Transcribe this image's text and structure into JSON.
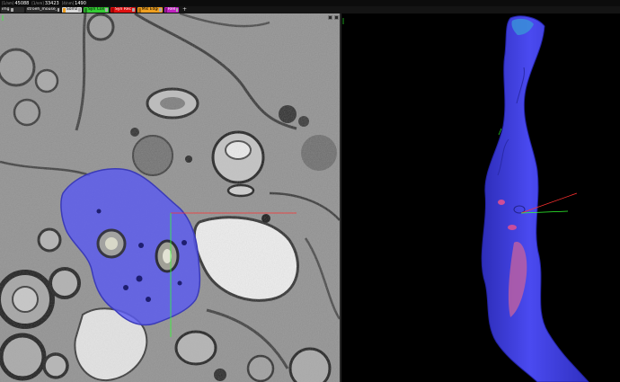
{
  "coordinates": [
    {
      "axis": "x",
      "label": "[1/nm]",
      "value": "45088"
    },
    {
      "axis": "y",
      "label": "[1/nm]",
      "value": "33423"
    },
    {
      "axis": "z",
      "label": "[4/nm]",
      "value": "1490"
    }
  ],
  "layers": [
    {
      "name": "img",
      "text_color": "#ffffff",
      "bg": "#2b2b2b",
      "swatch": ""
    },
    {
      "name": "stroeh_mouse_retina",
      "text_color": "#ffffff",
      "bg": "#2b2b2b",
      "swatch": ""
    },
    {
      "name": "Soma",
      "text_color": "#000000",
      "bg": "#d9d9d9",
      "swatch": "#f0a020"
    },
    {
      "name": "Syn Con",
      "text_color": "#000000",
      "bg": "#33cc33",
      "swatch": "#1f7f1f"
    },
    {
      "name": "Syn Rec",
      "text_color": "#ffffff",
      "bg": "#e01010",
      "swatch": "#aa0000"
    },
    {
      "name": "Mis Edge",
      "text_color": "#000000",
      "bg": "#f0a020",
      "swatch": "#b06a00"
    },
    {
      "name": "Remo",
      "text_color": "#ffffff",
      "bg": "#c020c0",
      "swatch": "#801080"
    }
  ],
  "add_layer_label": "+",
  "colors": {
    "segment_fill": "#5a5af0",
    "render_mesh": "#4646e6",
    "synapse": "#e05090",
    "crosshair_red": "#ff3030",
    "crosshair_green": "#30ff30"
  }
}
